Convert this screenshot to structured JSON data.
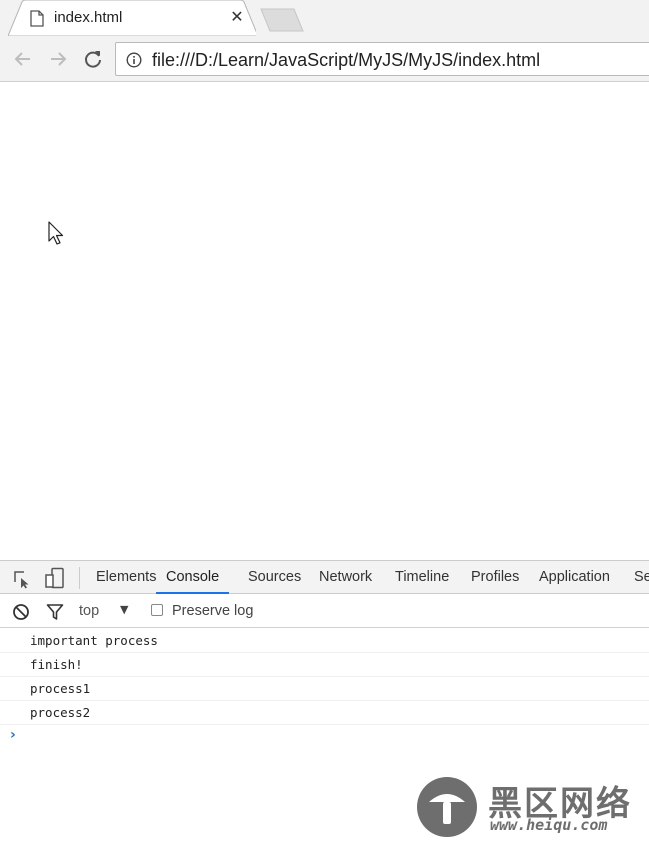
{
  "browser": {
    "tab": {
      "title": "index.html",
      "close_glyph": "✕"
    },
    "address_bar": {
      "url": "file:///D:/Learn/JavaScript/MyJS/MyJS/index.html"
    }
  },
  "devtools": {
    "tabs": [
      "Elements",
      "Console",
      "Sources",
      "Network",
      "Timeline",
      "Profiles",
      "Application",
      "Se"
    ],
    "active_tab": "Console",
    "filter_bar": {
      "context": "top",
      "context_arrow": "▼",
      "preserve_log_label": "Preserve log",
      "preserve_log_checked": false
    },
    "console_lines": [
      "important process",
      "finish!",
      "process1",
      "process2"
    ],
    "prompt_glyph": "›"
  },
  "watermark": {
    "title": "黑区网络",
    "url": "www.heiqu.com"
  },
  "colors": {
    "chrome_bg": "#f2f2f2",
    "devtools_accent": "#1a73e8",
    "watermark": "#6e6e6e"
  },
  "icons": [
    "document-icon",
    "close-icon",
    "back-arrow-icon",
    "forward-arrow-icon",
    "reload-icon",
    "info-icon",
    "mouse-cursor-icon",
    "inspect-element-icon",
    "device-toggle-icon",
    "clear-console-icon",
    "filter-icon",
    "prompt-chevron-icon",
    "watermark-logo"
  ]
}
